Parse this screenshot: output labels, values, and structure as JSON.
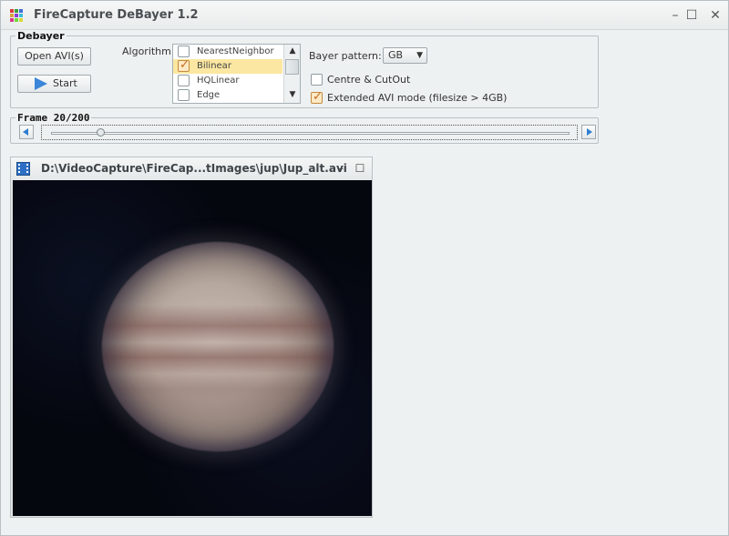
{
  "window": {
    "title": "FireCapture DeBayer 1.2",
    "controls": {
      "minimize": "–",
      "maximize": "☐",
      "close": "✕"
    },
    "icon_colors": [
      "#d83b3b",
      "#3b9f3b",
      "#3b6fd8",
      "#d8a03b",
      "#8a3bd8",
      "#3bbfd8",
      "#d83b8a",
      "#6fd83b",
      "#d8d83b"
    ]
  },
  "debayer": {
    "legend": "Debayer",
    "open_button": "Open AVI(s)",
    "start_button": "Start",
    "algorithm_label": "Algorithm:",
    "algorithms": [
      {
        "label": "NearestNeighbor",
        "checked": false,
        "selected": false
      },
      {
        "label": "Bilinear",
        "checked": true,
        "selected": true
      },
      {
        "label": "HQLinear",
        "checked": false,
        "selected": false
      },
      {
        "label": "Edge",
        "checked": false,
        "selected": false
      }
    ],
    "bayer_label": "Bayer pattern:",
    "bayer_value": "GB",
    "centre_cutout": {
      "label": "Centre & CutOut",
      "checked": false
    },
    "extended_avi": {
      "label": "Extended AVI mode (filesize > 4GB)",
      "checked": true
    }
  },
  "frame": {
    "legend": "Frame 20/200",
    "current": 20,
    "total": 200
  },
  "video": {
    "title": "D:\\VideoCapture\\FireCap...tImages\\jup\\Jup_alt.avi",
    "minimize": "–",
    "maximize": "☐"
  },
  "colors": {
    "accent": "#2f7fd0",
    "selection": "#fbe7a1",
    "check": "#c8681b"
  }
}
